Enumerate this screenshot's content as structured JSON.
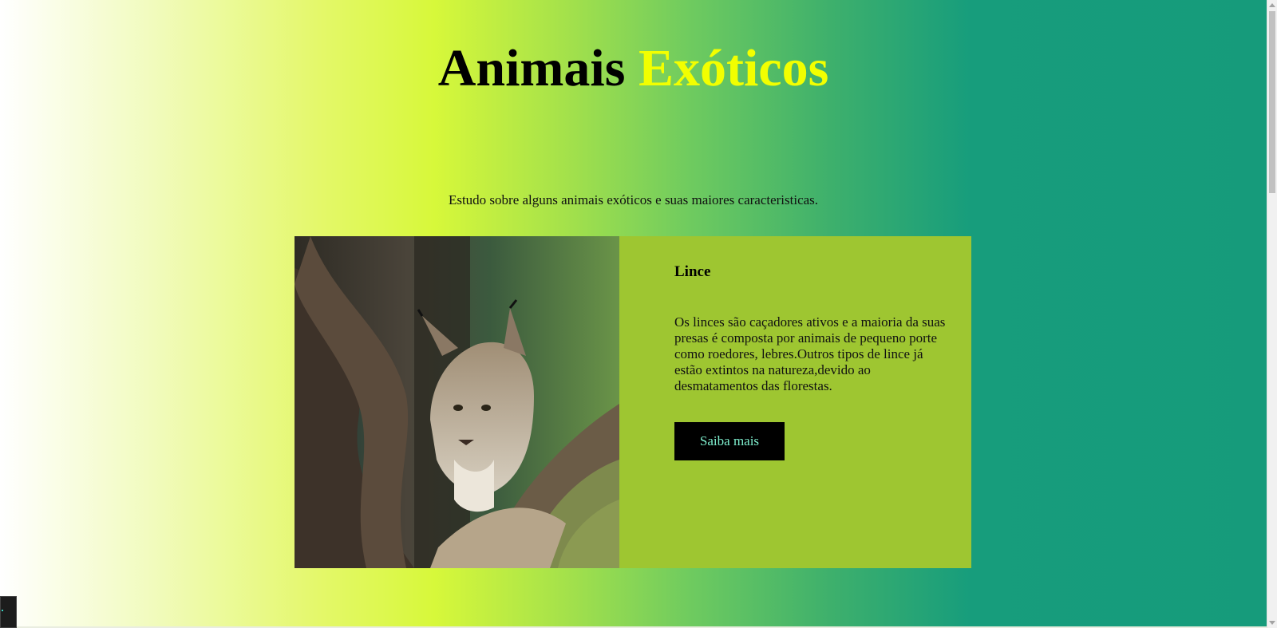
{
  "header": {
    "title_main": "Animais",
    "title_accent": "Exóticos",
    "subtitle": "Estudo sobre alguns animais exóticos e suas maiores caracteristicas."
  },
  "card": {
    "image_icon": "lynx-photo",
    "title": "Lince",
    "text": "Os linces são caçadores ativos e a maioria da suas presas é composta por animais de pequeno porte como roedores, lebres.Outros tipos de lince já estão extintos na natureza,devido ao desmatamentos das florestas.",
    "button_label": "Saiba mais"
  },
  "colors": {
    "card_background": "#9ec631",
    "title_accent": "#f2ff00",
    "button_background": "#000000",
    "button_text": "#7ff0cf",
    "gradient_right": "#169b7b"
  }
}
